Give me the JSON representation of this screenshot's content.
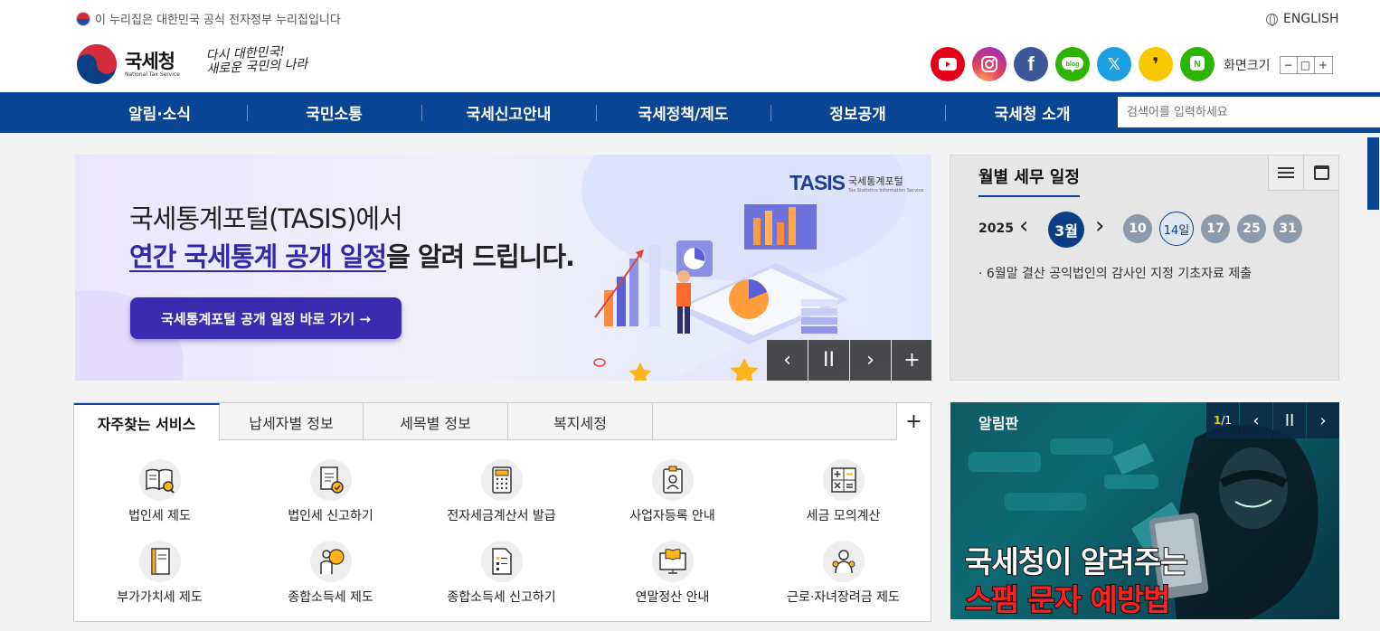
{
  "header": {
    "gov_notice": "이 누리집은 대한민국 공식 전자정부 누리집입니다",
    "english_label": "ENGLISH",
    "logo_title": "국세청",
    "logo_subtitle": "National Tax Service",
    "slogan_line1": "다시 대한민국!",
    "slogan_line2": "새로운 국민의 나라",
    "sns": [
      "youtube",
      "instagram",
      "facebook",
      "blog",
      "x",
      "kakao-story",
      "band"
    ],
    "font_size_label": "화면크기",
    "font_size_buttons": [
      "−",
      "□",
      "+"
    ]
  },
  "gnb": {
    "items": [
      "알림·소식",
      "국민소통",
      "국세신고안내",
      "국세정책/제도",
      "정보공개",
      "국세청 소개"
    ],
    "search_placeholder": "검색어를 입력하세요"
  },
  "banner": {
    "line1": "국세통계포털(TASIS)에서",
    "line2_highlight": "연간 국세통계 공개 일정",
    "line2_rest": "을 알려 드립니다.",
    "button_label": "국세통계포털 공개 일정 바로 가기 →",
    "tasis_mark": "TASIS",
    "tasis_name": "국세통계포털",
    "tasis_sub": "Tax Statistics Information Service",
    "controls": [
      "‹",
      "II",
      "›",
      "+"
    ]
  },
  "schedule": {
    "title": "월별 세무 일정",
    "year": "2025",
    "month": "3월",
    "days": [
      "10",
      "14일",
      "17",
      "25",
      "31"
    ],
    "active_day_index": 1,
    "item": "· 6월말 결산 공익법인의 감사인 지정 기초자료 제출"
  },
  "services": {
    "tabs": [
      "자주찾는 서비스",
      "납세자별 정보",
      "세목별 정보",
      "복지세정"
    ],
    "items": [
      {
        "label": "법인세 제도",
        "icon": "book-search-icon"
      },
      {
        "label": "법인세 신고하기",
        "icon": "document-check-icon"
      },
      {
        "label": "전자세금계산서 발급",
        "icon": "calculator-icon"
      },
      {
        "label": "사업자등록 안내",
        "icon": "id-badge-icon"
      },
      {
        "label": "세금 모의계산",
        "icon": "math-symbols-icon"
      },
      {
        "label": "부가가치세 제도",
        "icon": "notebook-icon"
      },
      {
        "label": "종합소득세 제도",
        "icon": "person-idea-icon"
      },
      {
        "label": "종합소득세 신고하기",
        "icon": "checklist-icon"
      },
      {
        "label": "연말정산 안내",
        "icon": "monitor-book-icon"
      },
      {
        "label": "근로·자녀장려금 제도",
        "icon": "family-icon"
      }
    ]
  },
  "board": {
    "title": "알림판",
    "counter_current": "1",
    "counter_total": "1",
    "line1": "국세청이 알려주는",
    "line2": "스팸 문자 예방법"
  },
  "colors": {
    "primary": "#0a4593",
    "banner_button": "#3a2bb0",
    "alert_red": "#ff1f1f"
  }
}
